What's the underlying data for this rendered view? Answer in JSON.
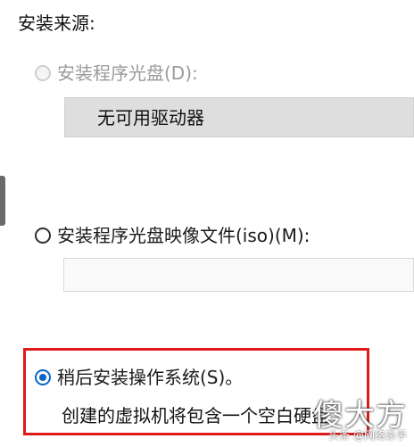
{
  "section": {
    "title": "安装来源:"
  },
  "options": [
    {
      "label": "安装程序光盘(D):",
      "state": "disabled"
    },
    {
      "label": "安装程序光盘映像文件(iso)(M):",
      "state": "unchecked"
    },
    {
      "label": "稍后安装操作系统(S)。",
      "state": "checked"
    }
  ],
  "drive_select": {
    "value": "无可用驱动器"
  },
  "iso_path": {
    "value": ""
  },
  "description": "创建的虚拟机将包含一个空白硬盘",
  "watermark": {
    "logo": "傻大方",
    "source": "头条 @网络杀手"
  },
  "colors": {
    "accent": "#0a64c8",
    "highlight": "#e01919",
    "disabled_text": "#9a9a9a"
  }
}
